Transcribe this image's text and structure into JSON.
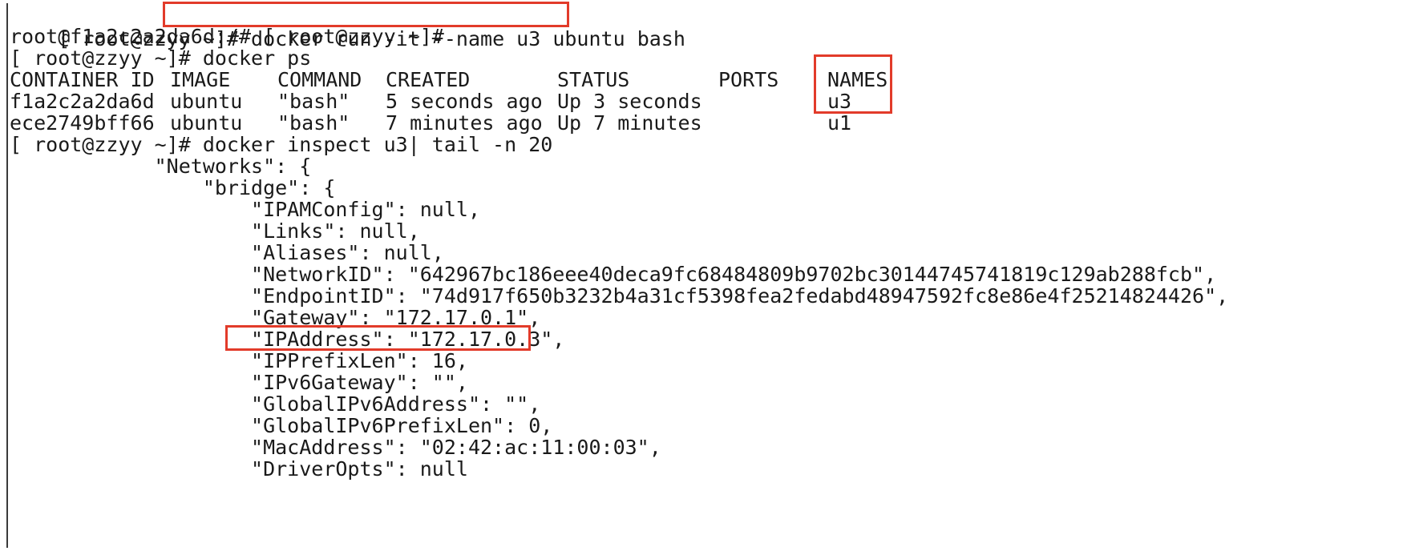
{
  "terminal": {
    "line1_prompt": "[ root@zzyy ~]# ",
    "line1_cmd": "docker run -it --name u3 ubuntu bash",
    "line2": "root@f1a2c2a2da6d:/# [ root@zzyy ~]#",
    "line3": "[ root@zzyy ~]# docker ps",
    "ps_table": {
      "headers": [
        "CONTAINER ID",
        "IMAGE",
        "COMMAND",
        "CREATED",
        "STATUS",
        "PORTS",
        "NAMES"
      ],
      "rows": [
        [
          "f1a2c2a2da6d",
          "ubuntu",
          "\"bash\"",
          "5 seconds ago",
          "Up 3 seconds",
          "",
          "u3"
        ],
        [
          "ece2749bff66",
          "ubuntu",
          "\"bash\"",
          "7 minutes ago",
          "Up 7 minutes",
          "",
          "u1"
        ]
      ]
    },
    "inspect_cmd": "[ root@zzyy ~]# docker inspect u3| tail -n 20",
    "inspect_lines": [
      "            \"Networks\": {",
      "                \"bridge\": {",
      "                    \"IPAMConfig\": null,",
      "                    \"Links\": null,",
      "                    \"Aliases\": null,",
      "                    \"NetworkID\": \"642967bc186eee40deca9fc68484809b9702bc30144745741819c129ab288fcb\",",
      "                    \"EndpointID\": \"74d917f650b3232b4a31cf5398fea2fedabd48947592fc8e86e4f25214824426\",",
      "                    \"Gateway\": \"172.17.0.1\",",
      "                    \"IPAddress\": \"172.17.0.3\",",
      "                    \"IPPrefixLen\": 16,",
      "                    \"IPv6Gateway\": \"\",",
      "                    \"GlobalIPv6Address\": \"\",",
      "                    \"GlobalIPv6PrefixLen\": 0,",
      "                    \"MacAddress\": \"02:42:ac:11:00:03\",",
      "                    \"DriverOpts\": null"
    ]
  },
  "colors": {
    "text": "#1a1a1a",
    "background": "#ffffff",
    "highlight": "#e23b2a"
  }
}
